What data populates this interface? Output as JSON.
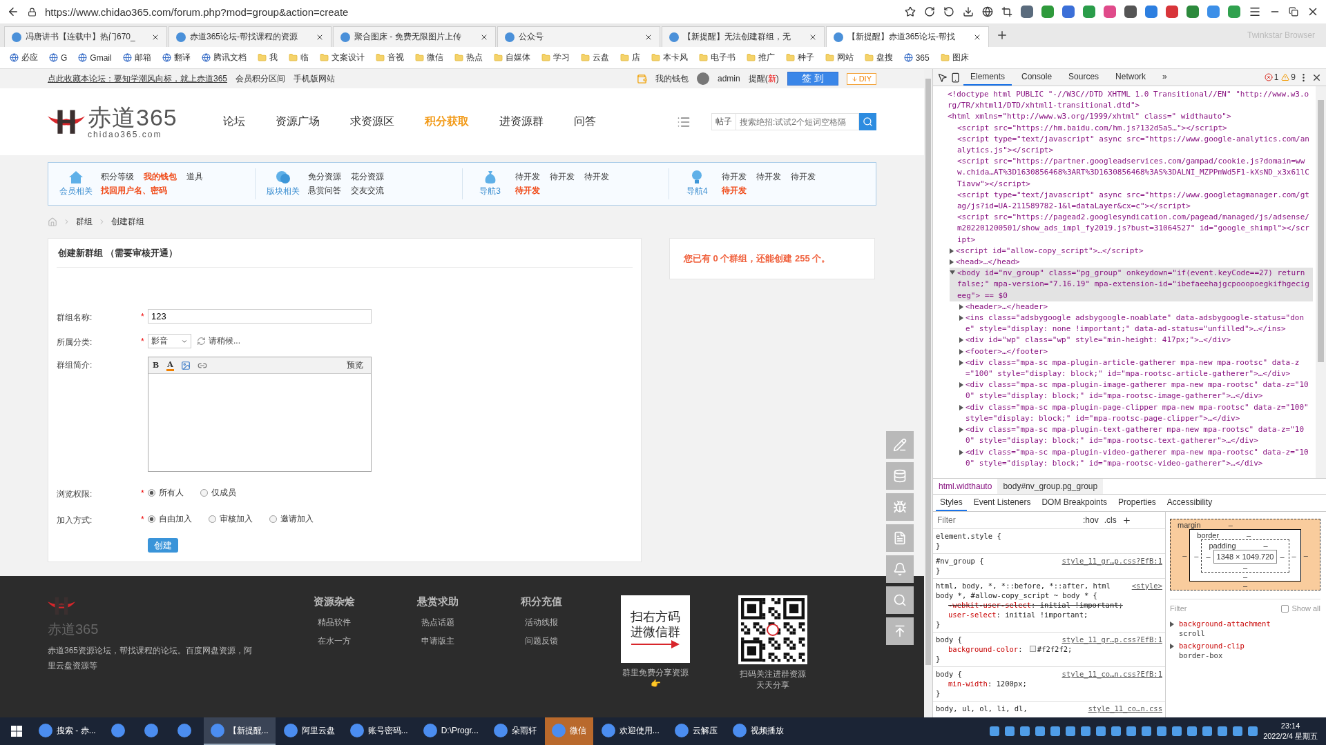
{
  "browser": {
    "url": "https://www.chidao365.com/forum.php?mod=group&action=create",
    "tabs": [
      {
        "title": "冯唐讲书【连载中】热门670_",
        "selected": false
      },
      {
        "title": "赤道365论坛-帮找课程的资源",
        "selected": false
      },
      {
        "title": "聚合图床 - 免费无限图片上传",
        "selected": false
      },
      {
        "title": "公众号",
        "selected": false
      },
      {
        "title": "【新提醒】无法创建群组，无",
        "selected": false
      },
      {
        "title": "【新提醒】赤道365论坛-帮找",
        "selected": true
      }
    ],
    "brand": "Twinkstar Browser",
    "bookmarks": [
      {
        "label": "必应",
        "kind": "site"
      },
      {
        "label": "G",
        "kind": "site"
      },
      {
        "label": "Gmail",
        "kind": "site"
      },
      {
        "label": "邮箱",
        "kind": "site"
      },
      {
        "label": "翻译",
        "kind": "site"
      },
      {
        "label": "腾讯文档",
        "kind": "site"
      },
      {
        "label": "我",
        "kind": "folder"
      },
      {
        "label": "临",
        "kind": "folder"
      },
      {
        "label": "文案设计",
        "kind": "folder"
      },
      {
        "label": "音视",
        "kind": "folder"
      },
      {
        "label": "微信",
        "kind": "folder"
      },
      {
        "label": "热点",
        "kind": "folder"
      },
      {
        "label": "自媒体",
        "kind": "folder"
      },
      {
        "label": "学习",
        "kind": "folder"
      },
      {
        "label": "云盘",
        "kind": "folder"
      },
      {
        "label": "店",
        "kind": "folder"
      },
      {
        "label": "本卡风",
        "kind": "folder"
      },
      {
        "label": "电子书",
        "kind": "folder"
      },
      {
        "label": "推广",
        "kind": "folder"
      },
      {
        "label": "种子",
        "kind": "folder"
      },
      {
        "label": "网站",
        "kind": "folder"
      },
      {
        "label": "盘搜",
        "kind": "folder"
      },
      {
        "label": "365",
        "kind": "site"
      },
      {
        "label": "图床",
        "kind": "folder"
      }
    ]
  },
  "page": {
    "top_bar": {
      "links": [
        "点此收藏本论坛：要知学潮风向标，就上赤道365",
        "会员积分区间",
        "手机版网站"
      ],
      "wallet": "我的钱包",
      "user": "admin",
      "reminder": {
        "prefix": "提醒(",
        "badge": "新",
        "suffix": ")"
      },
      "checkin": "签 到",
      "diy": "DIY"
    },
    "header": {
      "logo_text": "赤道365",
      "logo_domain": "chidao365.com",
      "nav": [
        {
          "label": "论坛",
          "selected": false
        },
        {
          "label": "资源广场",
          "selected": false
        },
        {
          "label": "求资源区",
          "selected": false
        },
        {
          "label": "积分获取",
          "selected": true
        },
        {
          "label": "进资源群",
          "selected": false
        },
        {
          "label": "问答",
          "selected": false
        }
      ],
      "search": {
        "type": "帖子",
        "placeholder": "搜索绝招:试试2个短词空格隔"
      }
    },
    "nav_box": [
      {
        "title": "会员相关",
        "links": [
          {
            "label": "积分等级",
            "highlight": false
          },
          {
            "label": "我的钱包",
            "highlight": true
          },
          {
            "label": "道具",
            "highlight": false
          },
          {
            "label": "找回用户名、密码",
            "highlight": true
          }
        ]
      },
      {
        "title": "版块相关",
        "links": [
          {
            "label": "免分资源",
            "highlight": false
          },
          {
            "label": "花分资源",
            "highlight": false
          },
          {
            "label": "悬赏问答",
            "highlight": false
          },
          {
            "label": "交友交流",
            "highlight": false
          }
        ]
      },
      {
        "title": "导航3",
        "links": [
          {
            "label": "待开发",
            "highlight": false
          },
          {
            "label": "待开发",
            "highlight": false
          },
          {
            "label": "待开发",
            "highlight": false
          },
          {
            "label": "待开发",
            "highlight": true
          }
        ]
      },
      {
        "title": "导航4",
        "links": [
          {
            "label": "待开发",
            "highlight": false
          },
          {
            "label": "待开发",
            "highlight": false
          },
          {
            "label": "待开发",
            "highlight": false
          },
          {
            "label": "待开发",
            "highlight": true
          }
        ]
      }
    ],
    "breadcrumb": [
      "群组",
      "创建群组"
    ],
    "form": {
      "title": "创建新群组 （需要审核开通）",
      "fields": [
        {
          "kind": "text",
          "label": "群组名称:",
          "mark": "*",
          "value": "123"
        },
        {
          "kind": "select",
          "label": "所属分类:",
          "mark": "*",
          "value": "影音",
          "status": "请稍候..."
        },
        {
          "kind": "editor",
          "label": "群组简介:",
          "tools": [
            "B",
            "A"
          ],
          "preview": "预览"
        },
        {
          "kind": "radio",
          "label": "浏览权限:",
          "mark": "*",
          "options": [
            {
              "label": "所有人",
              "selected": true
            },
            {
              "label": "仅成员",
              "selected": false
            }
          ]
        },
        {
          "kind": "radio",
          "label": "加入方式:",
          "mark": "*",
          "options": [
            {
              "label": "自由加入",
              "selected": true
            },
            {
              "label": "审核加入",
              "selected": false
            },
            {
              "label": "邀请加入",
              "selected": false
            }
          ]
        }
      ],
      "submit": "创建"
    },
    "side_note": "您已有 0 个群组，还能创建 255 个。",
    "footer": {
      "logo_text": "赤道365",
      "about": "赤道365资源论坛，帮找课程的论坛。百度网盘资源，阿里云盘资源等",
      "columns": [
        {
          "title": "资源杂烩",
          "links": [
            "精品软件",
            "在水一方"
          ]
        },
        {
          "title": "悬赏求助",
          "links": [
            "热点话题",
            "申请版主"
          ]
        },
        {
          "title": "积分充值",
          "links": [
            "活动线报",
            "问题反馈"
          ]
        }
      ],
      "promo": {
        "lines": [
          "扫右方码",
          "进微信群"
        ],
        "caption": "群里免费分享资源👉"
      },
      "qr_caption": "扫码关注进群资源天天分享"
    }
  },
  "devtools": {
    "tabs": [
      {
        "label": "Elements",
        "selected": true
      },
      {
        "label": "Console",
        "selected": false
      },
      {
        "label": "Sources",
        "selected": false
      },
      {
        "label": "Network",
        "selected": false
      }
    ],
    "more": "»",
    "errors": "1",
    "warnings": "9",
    "dom": [
      {
        "text": "<!doctype html PUBLIC \"-//W3C//DTD XHTML 1.0 Transitional//EN\" \"http://www.w3.org/TR/xhtml1/DTD/xhtml1-transitional.dtd\">"
      },
      {
        "text": "<html xmlns=\"http://www.w3.org/1999/xhtml\" class=\" widthauto\">",
        "children": [
          {
            "text": "<script src=\"https://hm.baidu.com/hm.js?132d5a5…\"></script>"
          },
          {
            "text": "<script type=\"text/javascript\" async src=\"https://www.google-analytics.com/analytics.js\"></script>"
          },
          {
            "text": "<script src=\"https://partner.googleadservices.com/gampad/cookie.js?domain=www.chida…AT%3D1630856468%3ART%3D1630856468%3AS%3DALNI_MZPPmWd5F1-kXsND_x3x61lCTiavw\"></script>"
          },
          {
            "text": "<script type=\"text/javascript\" async src=\"https://www.googletagmanager.com/gtag/js?id=UA-211589782-1&l=dataLayer&cx=c\"></script>"
          },
          {
            "text": "<script src=\"https://pagead2.googlesyndication.com/pagead/managed/js/adsense/m202201200501/show_ads_impl_fy2019.js?bust=31064527\" id=\"google_shimpl\"></script>"
          },
          {
            "text": "<script id=\"allow-copy_script\">…</script>",
            "expanded": false
          },
          {
            "text": "<head>…</head>",
            "expanded": false
          },
          {
            "text": "<body id=\"nv_group\" class=\"pg_group\" onkeydown=\"if(event.keyCode==27) return false;\" mpa-version=\"7.16.19\" mpa-extension-id=\"ibefaeehajgcpooopoegkifhgecigeeg\"> == $0",
            "expanded": true,
            "selected": true,
            "children": [
              {
                "text": "<header>…</header>",
                "expanded": false
              },
              {
                "text": "<ins class=\"adsbygoogle adsbygoogle-noablate\" data-adsbygoogle-status=\"done\" style=\"display: none !important;\" data-ad-status=\"unfilled\">…</ins>",
                "expanded": false
              },
              {
                "text": "<div id=\"wp\" class=\"wp\" style=\"min-height: 417px;\">…</div>",
                "expanded": false
              },
              {
                "text": "<footer>…</footer>",
                "expanded": false
              },
              {
                "text": "<div class=\"mpa-sc mpa-plugin-article-gatherer mpa-new mpa-rootsc\" data-z=\"100\" style=\"display: block;\" id=\"mpa-rootsc-article-gatherer\">…</div>",
                "expanded": false
              },
              {
                "text": "<div class=\"mpa-sc mpa-plugin-image-gatherer mpa-new mpa-rootsc\" data-z=\"100\" style=\"display: block;\" id=\"mpa-rootsc-image-gatherer\">…</div>",
                "expanded": false
              },
              {
                "text": "<div class=\"mpa-sc mpa-plugin-page-clipper mpa-new mpa-rootsc\" data-z=\"100\" style=\"display: block;\" id=\"mpa-rootsc-page-clipper\">…</div>",
                "expanded": false
              },
              {
                "text": "<div class=\"mpa-sc mpa-plugin-text-gatherer mpa-new mpa-rootsc\" data-z=\"100\" style=\"display: block;\" id=\"mpa-rootsc-text-gatherer\">…</div>",
                "expanded": false
              },
              {
                "text": "<div class=\"mpa-sc mpa-plugin-video-gatherer mpa-new mpa-rootsc\" data-z=\"100\" style=\"display: block;\" id=\"mpa-rootsc-video-gatherer\">…</div>",
                "expanded": false
              }
            ]
          }
        ]
      }
    ],
    "crumbs": [
      {
        "label": "html.widthauto",
        "selected": false
      },
      {
        "label": "body#nv_group.pg_group",
        "selected": true
      }
    ],
    "sub_tabs": [
      {
        "label": "Styles",
        "selected": true
      },
      {
        "label": "Event Listeners",
        "selected": false
      },
      {
        "label": "DOM Breakpoints",
        "selected": false
      },
      {
        "label": "Properties",
        "selected": false
      },
      {
        "label": "Accessibility",
        "selected": false
      }
    ],
    "filter": {
      "placeholder": "Filter"
    },
    "hov": ":hov",
    "cls": ".cls",
    "rules": [
      {
        "selector": "element.style {",
        "close": "}"
      },
      {
        "selector": "#nv_group {",
        "source": "style_11_gr…p.css?EfB:1",
        "close": "}"
      },
      {
        "selector": "html, body, *, *::before, *::after, html body *, #allow-copy_script ~ body * {",
        "source": "<style>",
        "props": [
          {
            "name": "-webkit-user-select",
            "value": ": initial !important;",
            "struck": true
          },
          {
            "name": "user-select",
            "value": ": initial !important;",
            "struck": false
          }
        ],
        "close": "}"
      },
      {
        "selector": "body {",
        "source": "style_11_gr…p.css?EfB:1",
        "props": [
          {
            "name": "background-color",
            "sep": ":",
            "value": "#f2f2f2;",
            "struck": false,
            "color": "#f2f2f2"
          }
        ],
        "close": "}"
      },
      {
        "selector": "body {",
        "source": "style_11_co…n.css?EfB:1",
        "props": [
          {
            "name": "min-width",
            "value": ": 1200px;",
            "struck": false
          }
        ],
        "close": "}"
      },
      {
        "selector": "body, ul, ol, li, dl,",
        "source": "style_11_co…n.css"
      }
    ],
    "box_model": {
      "label": "margin",
      "top": "–",
      "left": "–",
      "inner": {
        "label": "border",
        "top": "–",
        "left": "–",
        "inner": {
          "label": "padding",
          "top": "–",
          "left": "–",
          "content": "1348 × 1049.720",
          "right": "–",
          "bottom": "–"
        },
        "right": "–",
        "bottom": "–"
      },
      "right": "–",
      "bottom": "–"
    },
    "computed_filter": "Filter",
    "show_all": {
      "label": "Show all",
      "checked": false
    },
    "computed": [
      {
        "name": "background-attachment",
        "value": "scroll",
        "expanded": false
      },
      {
        "name": "background-clip",
        "value": "border-box",
        "expanded": false
      }
    ]
  },
  "taskbar": {
    "items": [
      {
        "kind": "app",
        "label": "搜索 - 赤...",
        "selected": false
      },
      {
        "kind": "icon",
        "selected": false
      },
      {
        "kind": "icon",
        "selected": false
      },
      {
        "kind": "icon",
        "selected": false
      },
      {
        "kind": "app",
        "label": "【新提醒...",
        "selected": true
      },
      {
        "kind": "app",
        "label": "阿里云盘",
        "selected": false
      },
      {
        "kind": "app",
        "label": "账号密码...",
        "selected": false
      },
      {
        "kind": "app",
        "label": "D:\\Progr...",
        "selected": false
      },
      {
        "kind": "app",
        "label": "朵雨轩",
        "selected": false
      },
      {
        "kind": "alert",
        "label": "微信",
        "selected": false
      },
      {
        "kind": "app",
        "label": "欢迎使用...",
        "selected": false
      },
      {
        "kind": "app",
        "label": "云解压",
        "selected": false
      },
      {
        "kind": "app",
        "label": "视频播放",
        "selected": false
      }
    ],
    "time": "23:14",
    "date": "2022/2/4 星期五"
  }
}
